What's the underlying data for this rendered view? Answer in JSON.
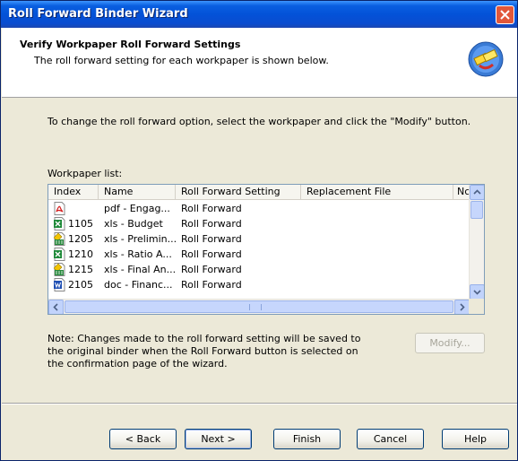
{
  "window": {
    "title": "Roll Forward Binder Wizard",
    "close_icon": "close-icon"
  },
  "header": {
    "title": "Verify Workpaper Roll Forward Settings",
    "subtitle": "The roll forward setting for each workpaper is shown below.",
    "icon": "wizard-icon"
  },
  "instructions": "To change the roll forward option, select the workpaper and click the \"Modify\" button.",
  "list": {
    "label": "Workpaper list:",
    "columns": [
      "Index",
      "Name",
      "Roll Forward Setting",
      "Replacement File",
      "Nc"
    ],
    "rows": [
      {
        "icon": "pdf-file-icon",
        "index": "",
        "name": "pdf - Engag...",
        "setting": "Roll Forward",
        "replacement": ""
      },
      {
        "icon": "excel-file-icon",
        "index": "1105",
        "name": "xls - Budget",
        "setting": "Roll Forward",
        "replacement": ""
      },
      {
        "icon": "excel-tb-file-icon",
        "index": "1205",
        "name": "xls - Prelimin...",
        "setting": "Roll Forward",
        "replacement": ""
      },
      {
        "icon": "excel-file-icon",
        "index": "1210",
        "name": "xls - Ratio A...",
        "setting": "Roll Forward",
        "replacement": ""
      },
      {
        "icon": "excel-tb-file-icon",
        "index": "1215",
        "name": "xls - Final An...",
        "setting": "Roll Forward",
        "replacement": ""
      },
      {
        "icon": "word-file-icon",
        "index": "2105",
        "name": "doc - Financ...",
        "setting": "Roll Forward",
        "replacement": ""
      }
    ]
  },
  "note": {
    "line1": "Note: Changes made to the roll forward setting will be saved to",
    "line2": "the original binder when the Roll Forward button is selected on",
    "line3": "the confirmation page of the wizard."
  },
  "buttons": {
    "modify": "Modify...",
    "back": "< Back",
    "next": "Next >",
    "finish": "Finish",
    "cancel": "Cancel",
    "help": "Help"
  },
  "colors": {
    "titlebar": "#0352d8",
    "dialog_bg": "#ece9d8",
    "close_button": "#e1573a"
  }
}
